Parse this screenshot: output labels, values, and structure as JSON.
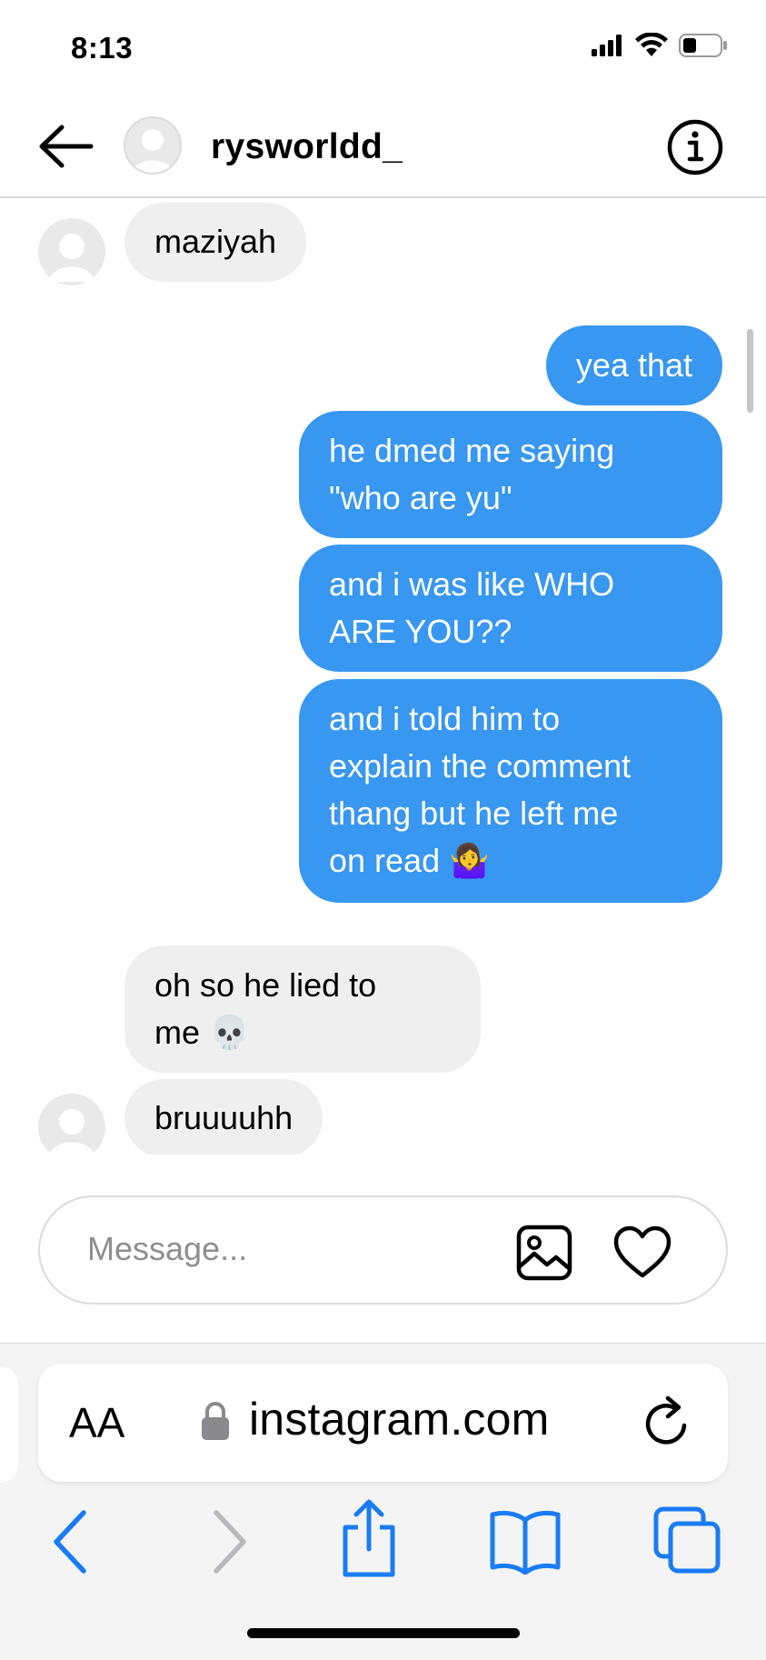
{
  "status_bar": {
    "time": "8:13"
  },
  "header": {
    "username": "rysworldd_"
  },
  "messages": [
    {
      "from": "them",
      "lines": [
        "maziyah"
      ]
    },
    {
      "from": "me",
      "lines": [
        "yea that"
      ]
    },
    {
      "from": "me",
      "lines": [
        "he dmed me saying",
        "\"who are yu\""
      ]
    },
    {
      "from": "me",
      "lines": [
        "and i was like WHO",
        "ARE YOU??"
      ]
    },
    {
      "from": "me",
      "lines": [
        "and i told him to",
        "explain the comment",
        "thang but he left me",
        "on read 🤷‍♀️"
      ]
    },
    {
      "from": "them",
      "lines": [
        "oh so he lied to",
        "me 💀"
      ]
    },
    {
      "from": "them",
      "lines": [
        "bruuuuhh"
      ]
    }
  ],
  "composer": {
    "placeholder": "Message..."
  },
  "browser": {
    "aa_label": "AA",
    "url": "instagram.com"
  },
  "colors": {
    "outgoing_bubble": "#3897f0",
    "incoming_bubble": "#efefef",
    "safari_blue": "#1a7cf5"
  },
  "icons": {
    "back": "arrow-left-icon",
    "info": "info-icon",
    "photo": "image-icon",
    "heart": "heart-icon",
    "lock": "lock-icon",
    "reload": "reload-icon",
    "nav_back": "chevron-left-icon",
    "nav_forward": "chevron-right-icon",
    "share": "share-icon",
    "bookmarks": "book-icon",
    "tabs": "tabs-icon"
  }
}
